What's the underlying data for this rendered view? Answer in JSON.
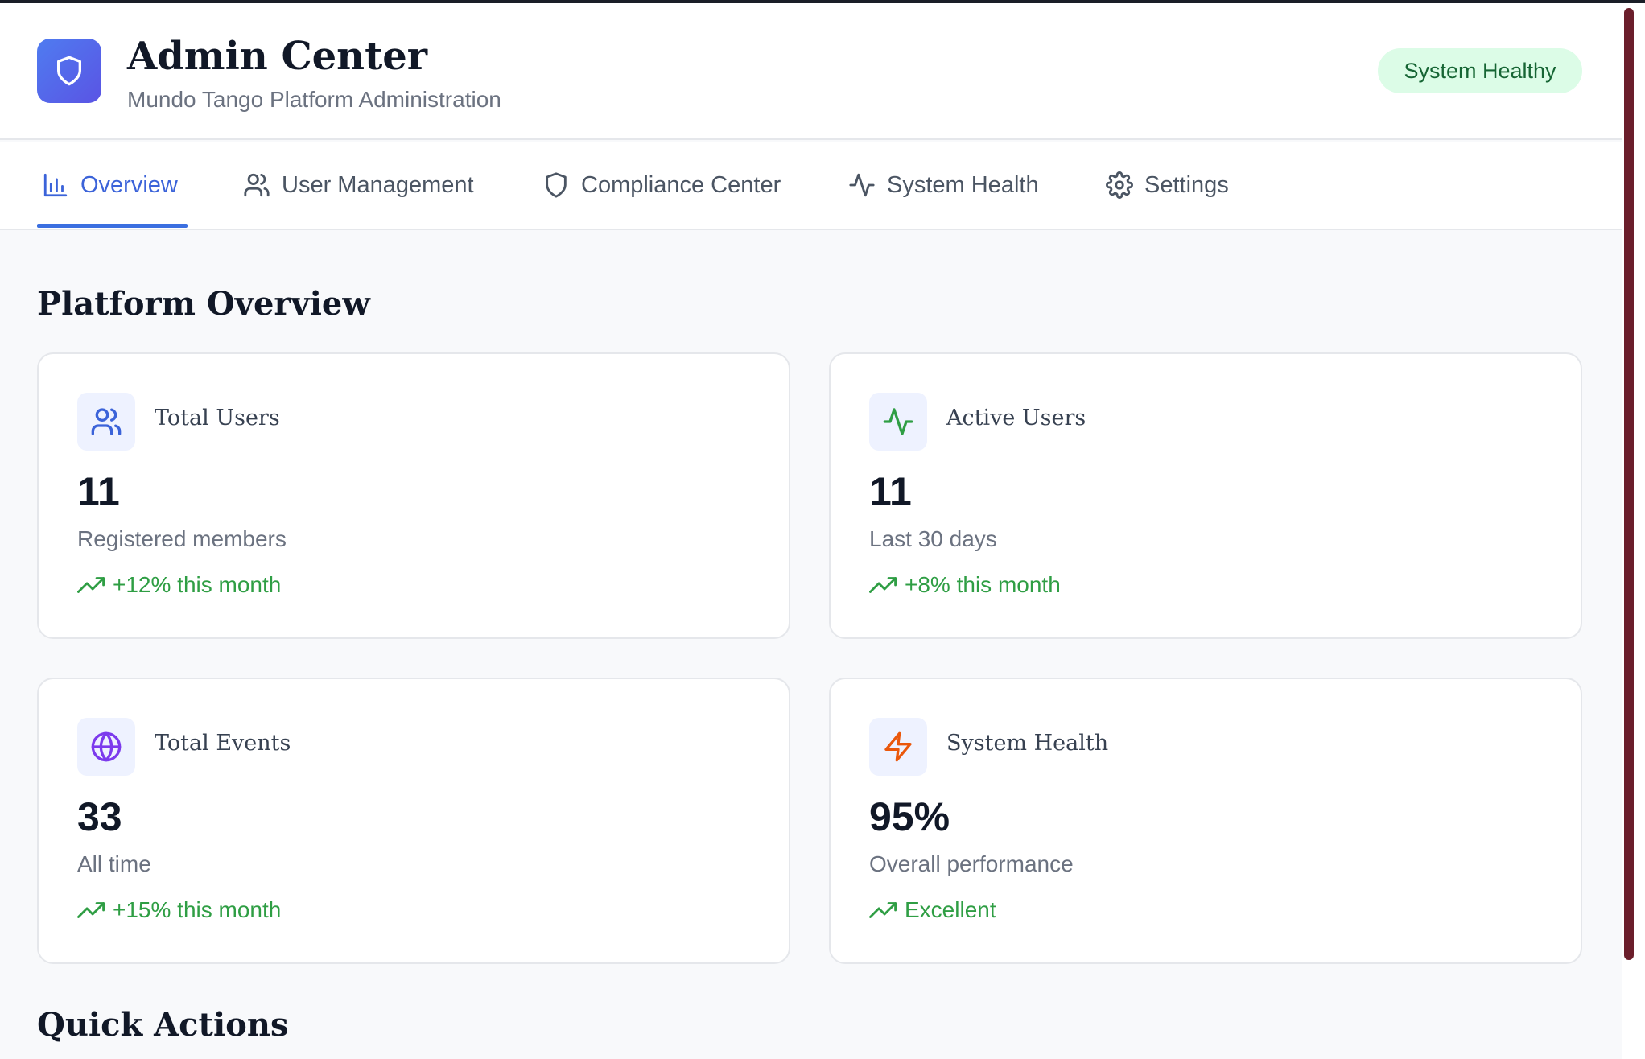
{
  "header": {
    "title": "Admin Center",
    "subtitle": "Mundo Tango Platform Administration",
    "status": "System Healthy"
  },
  "tabs": [
    {
      "label": "Overview",
      "icon": "bar-chart-icon",
      "active": true
    },
    {
      "label": "User Management",
      "icon": "users-icon",
      "active": false
    },
    {
      "label": "Compliance Center",
      "icon": "shield-icon",
      "active": false
    },
    {
      "label": "System Health",
      "icon": "activity-icon",
      "active": false
    },
    {
      "label": "Settings",
      "icon": "gear-icon",
      "active": false
    }
  ],
  "overview": {
    "title": "Platform Overview",
    "cards": [
      {
        "label": "Total Users",
        "value": "11",
        "description": "Registered members",
        "trend": "+12% this month",
        "icon": "users-icon",
        "icon_color": "#3b63d9"
      },
      {
        "label": "Active Users",
        "value": "11",
        "description": "Last 30 days",
        "trend": "+8% this month",
        "icon": "activity-icon",
        "icon_color": "#2f9e44"
      },
      {
        "label": "Total Events",
        "value": "33",
        "description": "All time",
        "trend": "+15% this month",
        "icon": "globe-icon",
        "icon_color": "#7c3aed"
      },
      {
        "label": "System Health",
        "value": "95%",
        "description": "Overall performance",
        "trend": "Excellent",
        "icon": "zap-icon",
        "icon_color": "#ea580c"
      }
    ]
  },
  "quick_actions": {
    "title": "Quick Actions"
  },
  "colors": {
    "accent": "#3b63d9",
    "positive": "#2f9e44",
    "status_bg": "#dcfce7",
    "status_text": "#166534"
  }
}
